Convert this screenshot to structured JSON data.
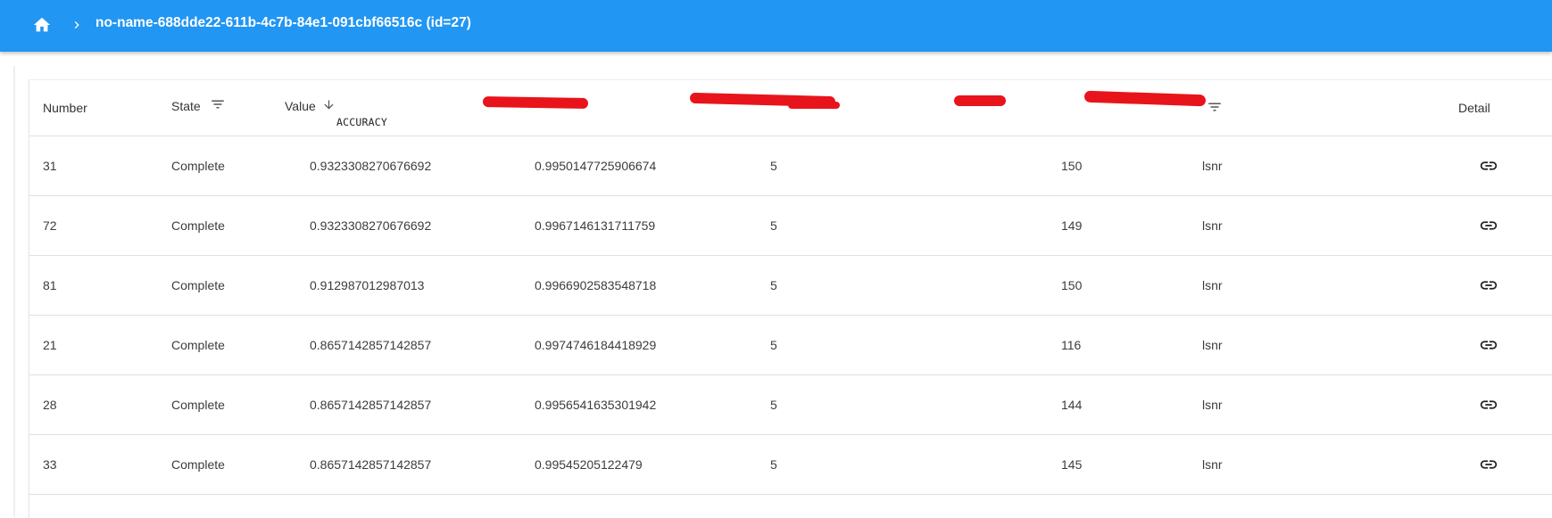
{
  "header": {
    "title": "no-name-688dde22-611b-4c7b-84e1-091cbf66516c (id=27)",
    "home_icon": "home-icon",
    "separator_icon": "chevron-right-icon",
    "accent_color": "#2196f3"
  },
  "table": {
    "columns": {
      "number": "Number",
      "state": "State",
      "value": "Value",
      "value_sub": "ACCURACY",
      "detail": "Detail"
    },
    "redacted_color": "#e8141b",
    "rows": [
      {
        "number": "31",
        "state": "Complete",
        "value": "0.9323308270676692",
        "col4": "0.9950147725906674",
        "col5": "5",
        "col6": "150",
        "col7": "lsnr"
      },
      {
        "number": "72",
        "state": "Complete",
        "value": "0.9323308270676692",
        "col4": "0.9967146131711759",
        "col5": "5",
        "col6": "149",
        "col7": "lsnr"
      },
      {
        "number": "81",
        "state": "Complete",
        "value": "0.912987012987013",
        "col4": "0.9966902583548718",
        "col5": "5",
        "col6": "150",
        "col7": "lsnr"
      },
      {
        "number": "21",
        "state": "Complete",
        "value": "0.8657142857142857",
        "col4": "0.9974746184418929",
        "col5": "5",
        "col6": "116",
        "col7": "lsnr"
      },
      {
        "number": "28",
        "state": "Complete",
        "value": "0.8657142857142857",
        "col4": "0.9956541635301942",
        "col5": "5",
        "col6": "144",
        "col7": "lsnr"
      },
      {
        "number": "33",
        "state": "Complete",
        "value": "0.8657142857142857",
        "col4": "0.99545205122479",
        "col5": "5",
        "col6": "145",
        "col7": "lsnr"
      }
    ]
  }
}
